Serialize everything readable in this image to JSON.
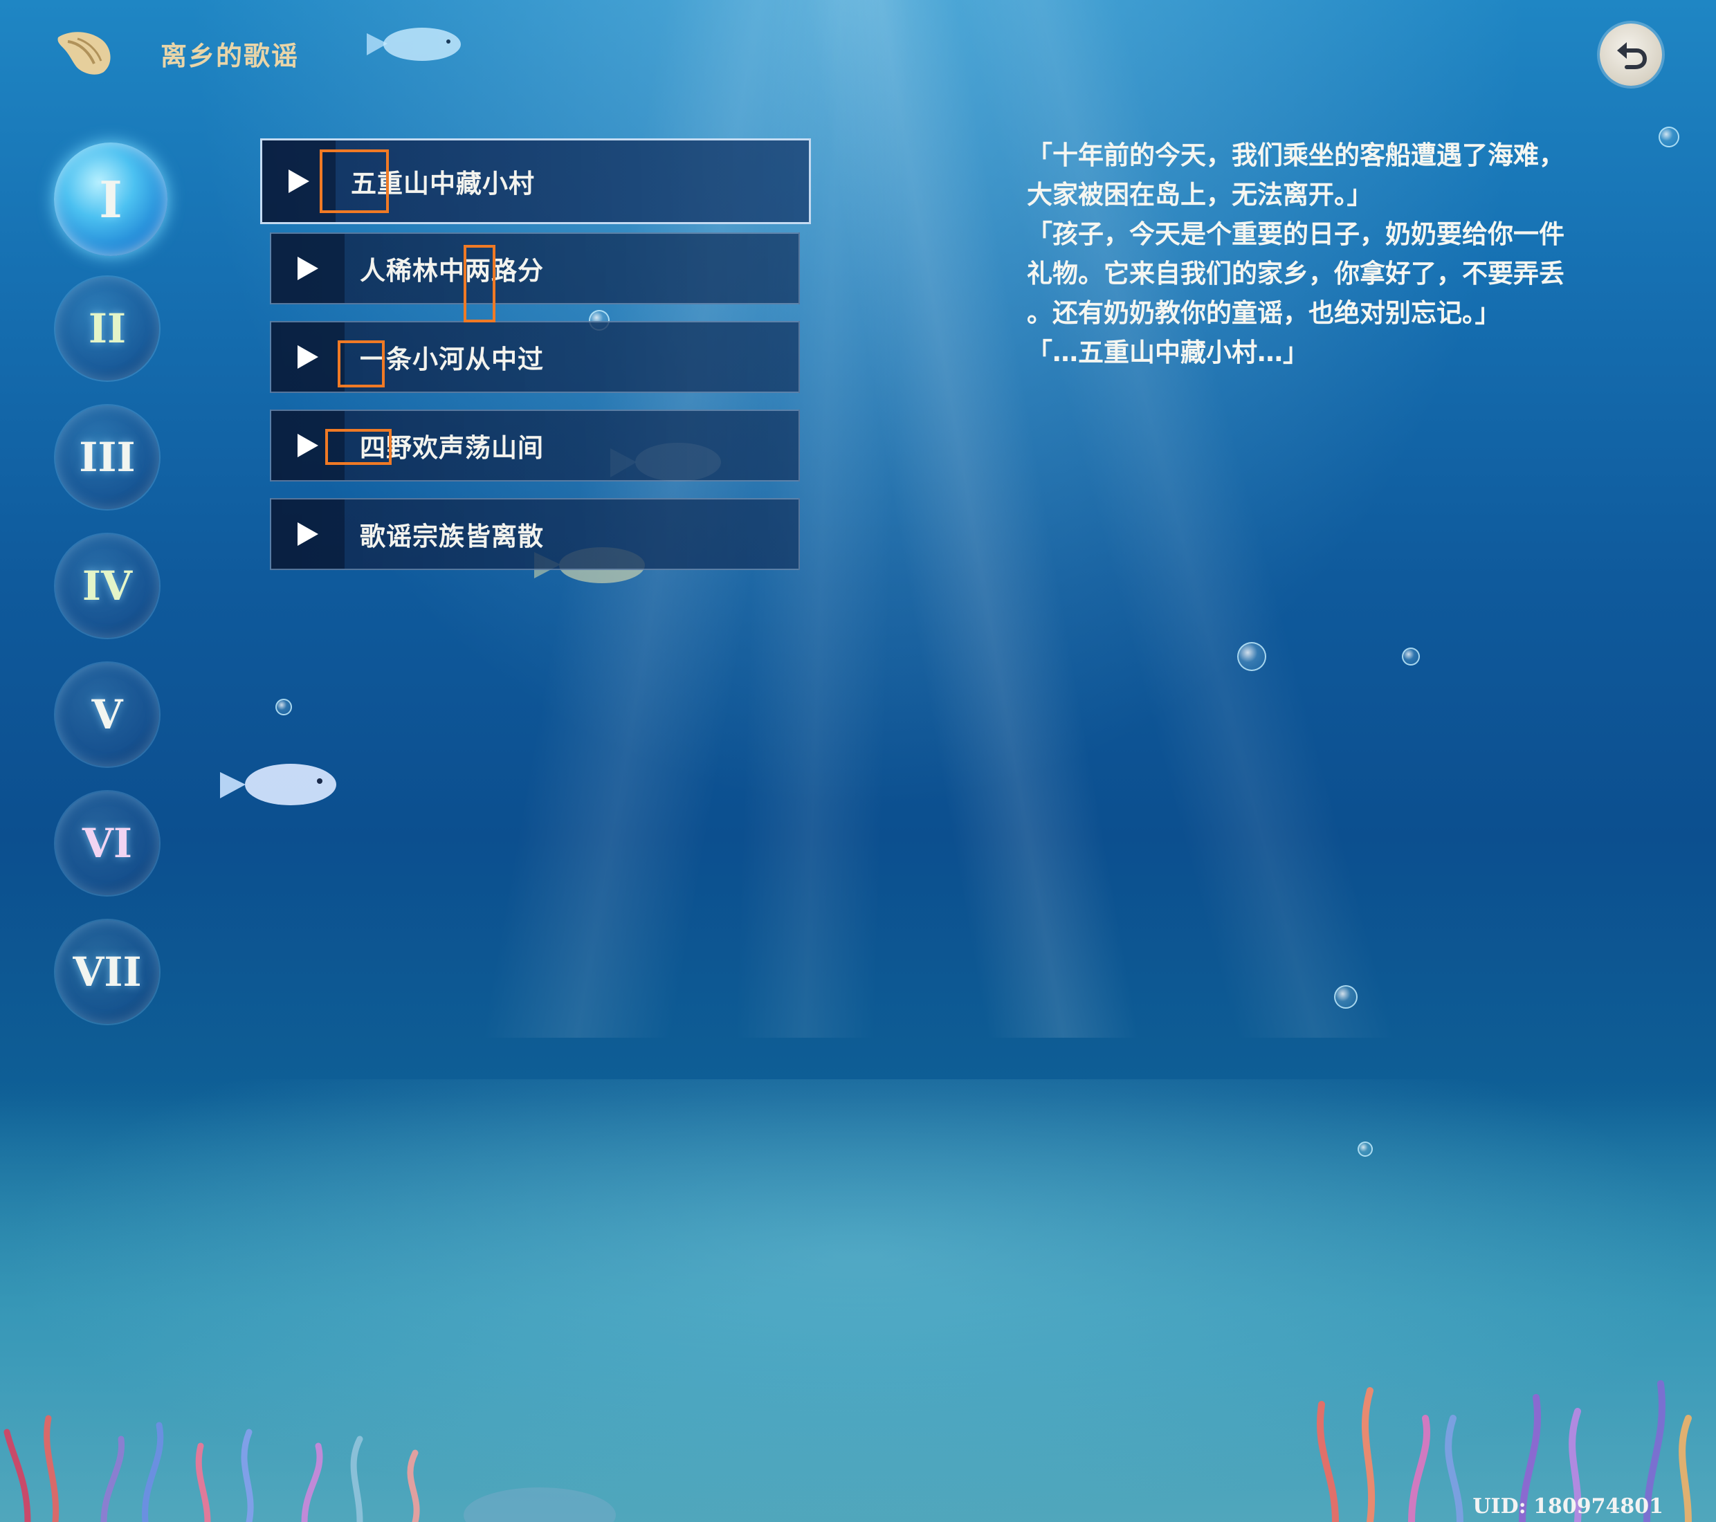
{
  "header": {
    "album_title": "离乡的歌谣"
  },
  "chapters": [
    {
      "label": "I",
      "active": true
    },
    {
      "label": "II",
      "active": false
    },
    {
      "label": "III",
      "active": false
    },
    {
      "label": "IV",
      "active": false
    },
    {
      "label": "V",
      "active": false
    },
    {
      "label": "VI",
      "active": false
    },
    {
      "label": "VII",
      "active": false
    }
  ],
  "songs": [
    {
      "title": "五重山中藏小村",
      "selected": true
    },
    {
      "title": "人稀林中两路分",
      "selected": false
    },
    {
      "title": "一条小河从中过",
      "selected": false
    },
    {
      "title": "四野欢声荡山间",
      "selected": false
    },
    {
      "title": "歌谣宗族皆离散",
      "selected": false
    }
  ],
  "lyrics": [
    "「十年前的今天，我们乘坐的客船遭遇了海难，",
    "大家被困在岛上，无法离开。」",
    "「孩子，今天是个重要的日子，奶奶要给你一件",
    "礼物。它来自我们的家乡，你拿好了，不要弄丢",
    "。还有奶奶教你的童谣，也绝对别忘记。」",
    "「…五重山中藏小村…」"
  ],
  "footer": {
    "uid": "UID: 180974801"
  },
  "icons": {
    "shell": "conch-shell-icon",
    "back": "undo-arrow-icon",
    "play": "play-triangle-icon"
  },
  "colors": {
    "title_gold": "#e9d5a8",
    "highlight_orange": "#f07a25",
    "water_top": "#1f86c4",
    "water_deep": "#0c4f8f"
  }
}
